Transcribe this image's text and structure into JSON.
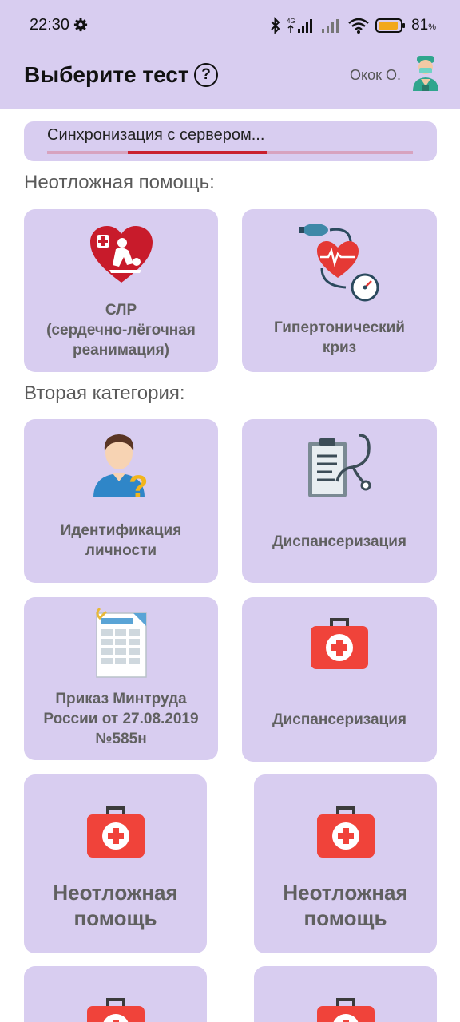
{
  "status_bar": {
    "time": "22:30",
    "battery": "81",
    "battery_unit": "%",
    "network_label": "4G"
  },
  "header": {
    "title": "Выберите тест",
    "help": "?",
    "user_name": "Окок О."
  },
  "sync": {
    "text": "Синхронизация с сервером...",
    "progress_start": 0.22,
    "progress_end": 0.6
  },
  "sections": [
    {
      "label": "Неотложная помощь:",
      "cards": [
        {
          "label": "СЛР\n(сердечно-лёгочная\nреанимация)",
          "icon": "heart-cpr-icon"
        },
        {
          "label": "Гипертонический\nкриз",
          "icon": "blood-pressure-icon"
        }
      ]
    },
    {
      "label": "Вторая категория:",
      "cards": [
        {
          "label": "Идентификация\nличности",
          "icon": "person-question-icon"
        },
        {
          "label": "Диспансеризация",
          "icon": "clipboard-stethoscope-icon"
        },
        {
          "label": "Приказ Минтруда\nРоссии от 27.08.2019\n№585н",
          "icon": "spreadsheet-document-icon"
        },
        {
          "label": "Диспансеризация",
          "icon": "first-aid-kit-icon"
        },
        {
          "label": "Неотложная\nпомощь",
          "icon": "first-aid-kit-icon"
        },
        {
          "label": "Неотложная\nпомощь",
          "icon": "first-aid-kit-icon"
        },
        {
          "label": "",
          "icon": "first-aid-kit-icon"
        },
        {
          "label": "",
          "icon": "first-aid-kit-icon"
        }
      ]
    }
  ],
  "colors": {
    "accent": "#d8cdf0",
    "kit_red": "#f0433a",
    "progress_red": "#c9202e"
  }
}
